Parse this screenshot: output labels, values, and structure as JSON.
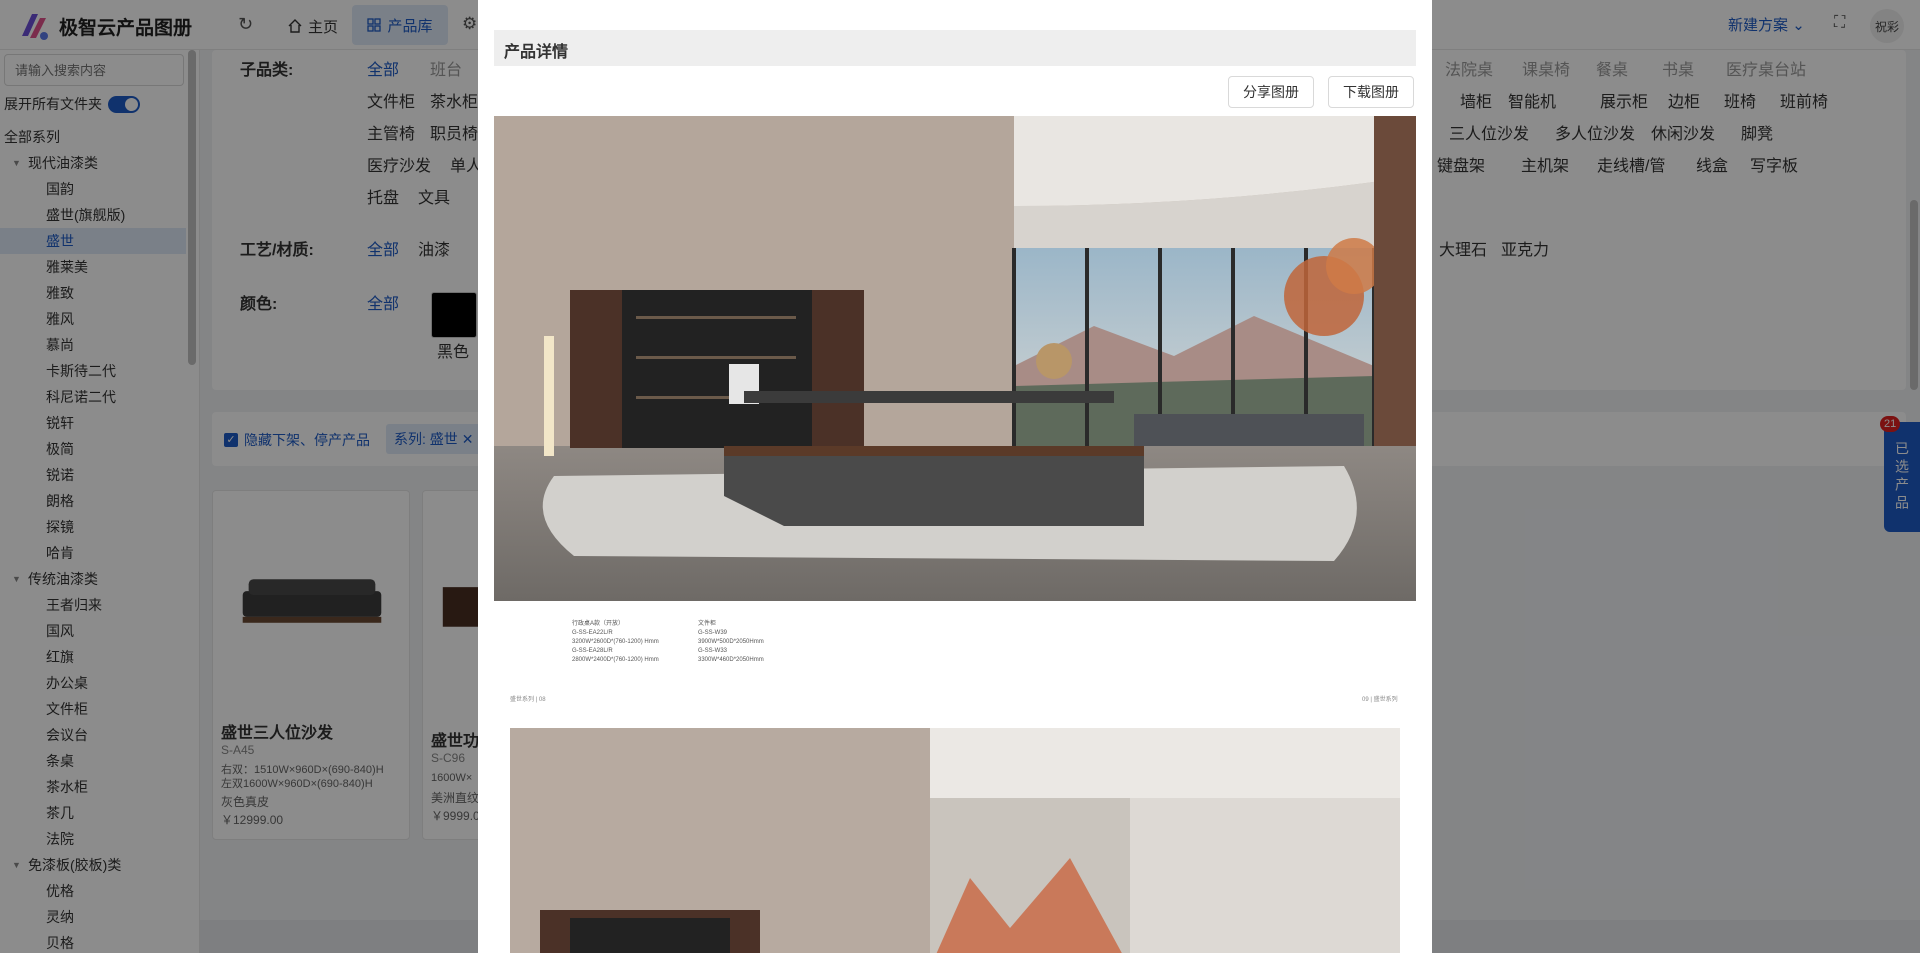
{
  "header": {
    "brand": "极智云产品图册",
    "nav_home": "主页",
    "nav_products": "产品库",
    "new_plan": "新建方案",
    "user": "祝彩"
  },
  "sidebar": {
    "search_placeholder": "请输入搜索内容",
    "expand_all": "展开所有文件夹",
    "tree": [
      {
        "label": "全部系列",
        "level": 0
      },
      {
        "label": "现代油漆类",
        "level": 1,
        "caret": true
      },
      {
        "label": "国韵",
        "level": 2
      },
      {
        "label": "盛世(旗舰版)",
        "level": 2
      },
      {
        "label": "盛世",
        "level": 2,
        "active": true
      },
      {
        "label": "雅莱美",
        "level": 2
      },
      {
        "label": "雅致",
        "level": 2
      },
      {
        "label": "雅风",
        "level": 2
      },
      {
        "label": "慕尚",
        "level": 2
      },
      {
        "label": "卡斯待二代",
        "level": 2
      },
      {
        "label": "科尼诺二代",
        "level": 2
      },
      {
        "label": "锐轩",
        "level": 2
      },
      {
        "label": "极简",
        "level": 2
      },
      {
        "label": "锐诺",
        "level": 2
      },
      {
        "label": "朗格",
        "level": 2
      },
      {
        "label": "探镜",
        "level": 2
      },
      {
        "label": "哈肯",
        "level": 2
      },
      {
        "label": "传统油漆类",
        "level": 1,
        "caret": true
      },
      {
        "label": "王者归来",
        "level": 2
      },
      {
        "label": "国风",
        "level": 2
      },
      {
        "label": "红旗",
        "level": 2
      },
      {
        "label": "办公桌",
        "level": 2
      },
      {
        "label": "文件柜",
        "level": 2
      },
      {
        "label": "会议台",
        "level": 2
      },
      {
        "label": "条桌",
        "level": 2
      },
      {
        "label": "茶水柜",
        "level": 2
      },
      {
        "label": "茶几",
        "level": 2
      },
      {
        "label": "法院",
        "level": 2
      },
      {
        "label": "免漆板(胶板)类",
        "level": 1,
        "caret": true
      },
      {
        "label": "优格",
        "level": 2
      },
      {
        "label": "灵纳",
        "level": 2
      },
      {
        "label": "贝格",
        "level": 2
      }
    ]
  },
  "filters": {
    "subcategory_label": "子品类:",
    "craft_label": "工艺/材质:",
    "color_label": "颜色:",
    "all": "全部",
    "row0_left": [
      "班台"
    ],
    "row0_right": [
      "法院桌",
      "课桌椅",
      "餐桌",
      "书桌",
      "医疗桌台站"
    ],
    "row1_left": [
      "文件柜",
      "茶水柜"
    ],
    "row1_right": [
      "墙柜",
      "智能机",
      "展示柜",
      "边柜",
      "班椅",
      "班前椅"
    ],
    "row2_left": [
      "主管椅",
      "职员椅"
    ],
    "row2_right": [
      "三人位沙发",
      "多人位沙发",
      "休闲沙发",
      "脚凳"
    ],
    "row3_left": [
      "医疗沙发",
      "单人"
    ],
    "row3_right": [
      "键盘架",
      "主机架",
      "走线槽/管",
      "线盒",
      "写字板"
    ],
    "row4_left": [
      "托盘",
      "文具"
    ],
    "craft_left": [
      "油漆"
    ],
    "craft_right": [
      "大理石",
      "亚克力"
    ],
    "color_black": "黑色"
  },
  "tagbar": {
    "hide_offshelf": "隐藏下架、停产产品",
    "series_tag": "系列: 盛世"
  },
  "products": [
    {
      "name": "盛世三人位沙发",
      "code": "S-A45",
      "dims": [
        "右双：1510W×960D×(690-840)H",
        "左双1600W×960D×(690-840)H"
      ],
      "material": "灰色真皮",
      "price": "￥12999.00"
    },
    {
      "name": "盛世功",
      "code": "S-C96",
      "dims": [
        "1600W×"
      ],
      "material": "美洲直纹",
      "price": "￥9999.0"
    }
  ],
  "selected": {
    "label": "已选产品",
    "count": "21"
  },
  "modal": {
    "title": "产品详情",
    "share": "分享图册",
    "download": "下载图册",
    "specs": [
      {
        "title": "行政桌A款（开放）",
        "lines": [
          "G-SS-EA22L/R",
          "3200W*2600D*(760-1200) Hmm",
          "G-SS-EA28L/R",
          "2800W*2400D*(760-1200) Hmm"
        ]
      },
      {
        "title": "文件柜",
        "lines": [
          "G-SS-W39",
          "3900W*500D*2050Hmm",
          "G-SS-W33",
          "3300W*460D*2050Hmm"
        ]
      }
    ],
    "page_left": "盛世系列 | 08",
    "page_right": "09 | 盛世系列"
  }
}
